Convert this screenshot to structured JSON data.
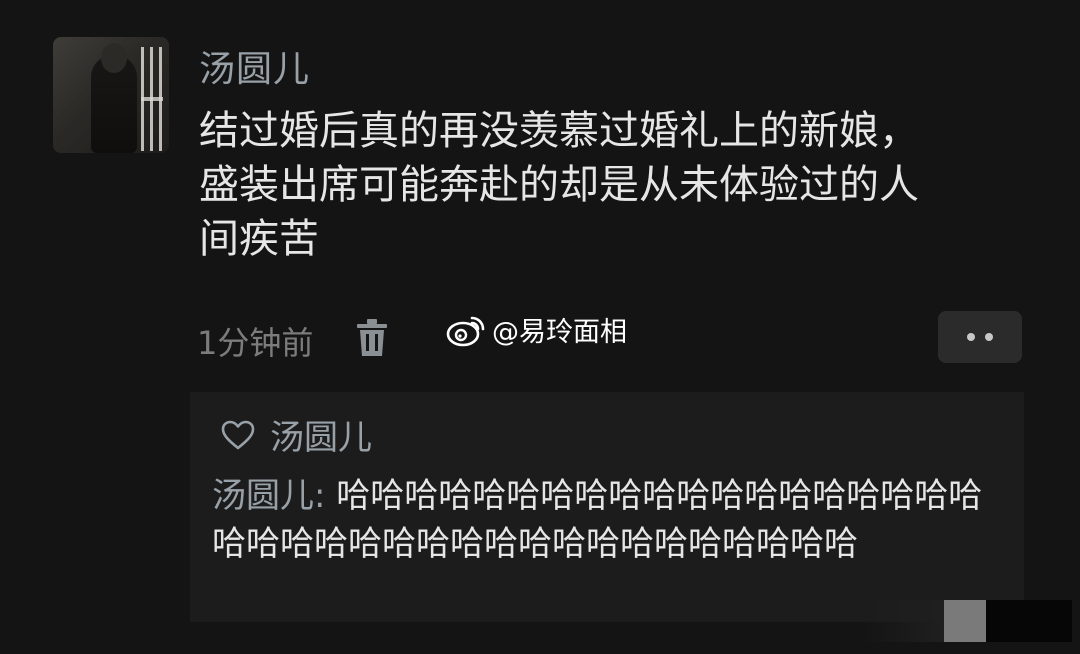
{
  "post": {
    "author": "汤圆儿",
    "text": "结过婚后真的再没羡慕过婚礼上的新娘，\n盛装出席可能奔赴的却是从未体验过的人\n间疾苦",
    "time": "1分钟前"
  },
  "watermark": {
    "text": "@易玲面相"
  },
  "reply": {
    "liker": "汤圆儿",
    "author_prefix": "汤圆儿: ",
    "text": "哈哈哈哈哈哈哈哈哈哈哈哈哈哈哈哈哈哈哈哈哈哈哈哈哈哈哈哈哈哈哈哈哈哈哈哈哈哈"
  }
}
